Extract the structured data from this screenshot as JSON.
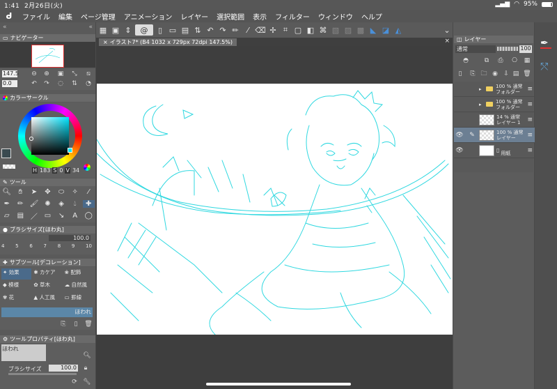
{
  "status": {
    "time": "1:41",
    "date": "2月26日(火)",
    "battery": "95%"
  },
  "menu": [
    "ファイル",
    "編集",
    "ページ管理",
    "アニメーション",
    "レイヤー",
    "選択範囲",
    "表示",
    "フィルター",
    "ウィンドウ",
    "ヘルプ"
  ],
  "navigator": {
    "title": "ナビゲーター",
    "zoom": "147.5",
    "rotate": "0.0"
  },
  "color": {
    "title": "カラーサークル",
    "h": "183",
    "s": "0",
    "v": "34",
    "h_label": "H",
    "s_label": "S",
    "v_label": "V",
    "current_hex": "#3a4a50"
  },
  "tool": {
    "title": "ツール"
  },
  "brush": {
    "title": "ブラシサイズ[ほわ丸]",
    "value": "100.0",
    "presets": [
      "4",
      "5",
      "6",
      "7",
      "8",
      "9",
      "10"
    ]
  },
  "subtool": {
    "title": "サブツール[デコレーション]",
    "items": [
      "効果",
      "カケア",
      "配飾",
      "模様",
      "草木",
      "自然風",
      "花",
      "人工風",
      "罫線"
    ],
    "selected": "ほわれ"
  },
  "toolprop": {
    "title": "ツールプロパティ[ほわ丸]",
    "name": "ほわれ",
    "brush_label": "ブラシサイズ",
    "brush_value": "100.0"
  },
  "canvas": {
    "tab": "イラスト7* (B4 1032 x 729px 72dpi 147.5%)"
  },
  "layers": {
    "title": "レイヤー",
    "blend": "通常",
    "opacity": "100",
    "items": [
      {
        "pct": "100 %",
        "mode": "通常",
        "name": "フォルダー",
        "type": "folder"
      },
      {
        "pct": "100 %",
        "mode": "通常",
        "name": "フォルダー",
        "type": "folder"
      },
      {
        "pct": "14 %",
        "mode": "通常",
        "name": "レイヤー 1",
        "type": "raster"
      },
      {
        "pct": "100 %",
        "mode": "通常",
        "name": "レイヤー",
        "type": "raster",
        "selected": true
      },
      {
        "pct": "",
        "mode": "",
        "name": "用紙",
        "type": "paper"
      }
    ]
  },
  "colors": {
    "sketch": "#2fd8e0",
    "accent": "#4a90d9"
  }
}
